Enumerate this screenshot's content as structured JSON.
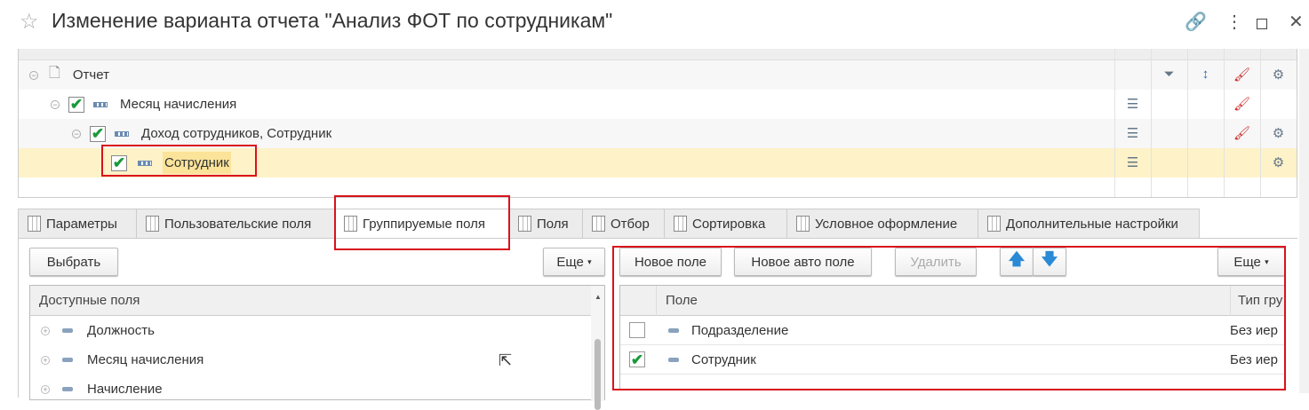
{
  "window": {
    "title": "Изменение варианта отчета \"Анализ ФОТ по сотрудникам\""
  },
  "tree": {
    "rows": [
      {
        "label": "Отчет",
        "level": 0,
        "checked": null
      },
      {
        "label": "Месяц начисления",
        "level": 1,
        "checked": true
      },
      {
        "label": "Доход сотрудников, Сотрудник",
        "level": 2,
        "checked": true
      },
      {
        "label": "Сотрудник",
        "level": 3,
        "checked": true,
        "selected": true
      }
    ]
  },
  "tabs": [
    {
      "label": "Параметры"
    },
    {
      "label": "Пользовательские поля"
    },
    {
      "label": "Группируемые поля",
      "active": true
    },
    {
      "label": "Поля"
    },
    {
      "label": "Отбор"
    },
    {
      "label": "Сортировка"
    },
    {
      "label": "Условное оформление"
    },
    {
      "label": "Дополнительные настройки"
    }
  ],
  "left": {
    "select_label": "Выбрать",
    "more_label": "Еще",
    "header": "Доступные поля",
    "items": [
      "Должность",
      "Месяц начисления",
      "Начисление"
    ]
  },
  "right": {
    "new_field": "Новое поле",
    "new_auto_field": "Новое авто поле",
    "delete": "Удалить",
    "more_label": "Еще",
    "col_field": "Поле",
    "col_type": "Тип гру",
    "rows": [
      {
        "field": "Подразделение",
        "type": "Без иер",
        "checked": false
      },
      {
        "field": "Сотрудник",
        "type": "Без иер",
        "checked": true
      }
    ]
  },
  "colors": {
    "accent_red": "#d9121c",
    "selected_row": "#fdf2c8",
    "check": "#1a9a3a"
  }
}
